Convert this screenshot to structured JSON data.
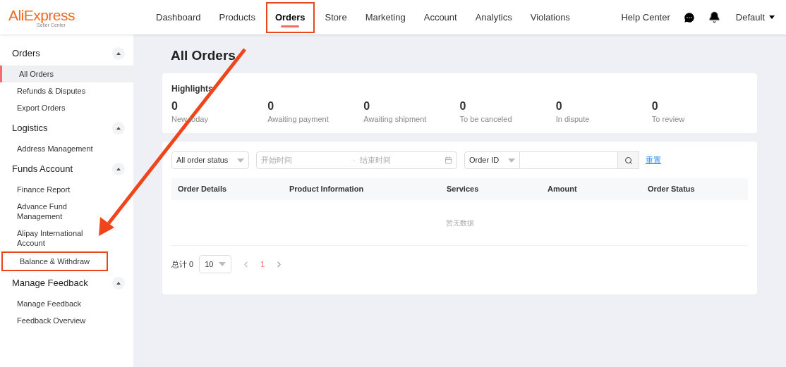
{
  "logo": {
    "name": "AliExpress",
    "subtitle": "Seller Center"
  },
  "nav": [
    {
      "label": "Dashboard",
      "selected": false,
      "highlighted": false
    },
    {
      "label": "Products",
      "selected": false,
      "highlighted": false
    },
    {
      "label": "Orders",
      "selected": true,
      "highlighted": true
    },
    {
      "label": "Store",
      "selected": false,
      "highlighted": false
    },
    {
      "label": "Marketing",
      "selected": false,
      "highlighted": false
    },
    {
      "label": "Account",
      "selected": false,
      "highlighted": false
    },
    {
      "label": "Analytics",
      "selected": false,
      "highlighted": false
    },
    {
      "label": "Violations",
      "selected": false,
      "highlighted": false
    }
  ],
  "header_right": {
    "help": "Help Center",
    "account": "Default"
  },
  "sidebar": [
    {
      "title": "Orders",
      "expanded": true,
      "items": [
        {
          "label": "All Orders",
          "selected": true,
          "highlighted": false
        },
        {
          "label": "Refunds & Disputes",
          "selected": false,
          "highlighted": false
        },
        {
          "label": "Export Orders",
          "selected": false,
          "highlighted": false
        }
      ]
    },
    {
      "title": "Logistics",
      "expanded": true,
      "items": [
        {
          "label": "Address Management",
          "selected": false,
          "highlighted": false
        }
      ]
    },
    {
      "title": "Funds Account",
      "expanded": true,
      "items": [
        {
          "label": "Finance Report",
          "selected": false,
          "highlighted": false
        },
        {
          "label": "Advance Fund Management",
          "selected": false,
          "highlighted": false
        },
        {
          "label": "Alipay International Account",
          "selected": false,
          "highlighted": false
        },
        {
          "label": "Balance & Withdraw",
          "selected": false,
          "highlighted": true
        }
      ]
    },
    {
      "title": "Manage Feedback",
      "expanded": true,
      "items": [
        {
          "label": "Manage Feedback",
          "selected": false,
          "highlighted": false
        },
        {
          "label": "Feedback Overview",
          "selected": false,
          "highlighted": false
        }
      ]
    }
  ],
  "page_title": "All Orders",
  "highlights": {
    "title": "Highlights",
    "stats": [
      {
        "value": "0",
        "label": "New today"
      },
      {
        "value": "0",
        "label": "Awaiting payment"
      },
      {
        "value": "0",
        "label": "Awaiting shipment"
      },
      {
        "value": "0",
        "label": "To be canceled"
      },
      {
        "value": "0",
        "label": "In dispute"
      },
      {
        "value": "0",
        "label": "To review"
      }
    ]
  },
  "filters": {
    "status": "All order status",
    "start_placeholder": "开始时间",
    "separator": "-",
    "end_placeholder": "结束时间",
    "search_type": "Order ID",
    "reset": "重置"
  },
  "table": {
    "columns": [
      "Order Details",
      "Product Information",
      "Services",
      "Amount",
      "Order Status"
    ],
    "empty": "暂无数据"
  },
  "pagination": {
    "total": "总计 0",
    "page_size": "10",
    "pages": [
      {
        "label": "1",
        "selected": true
      }
    ]
  }
}
